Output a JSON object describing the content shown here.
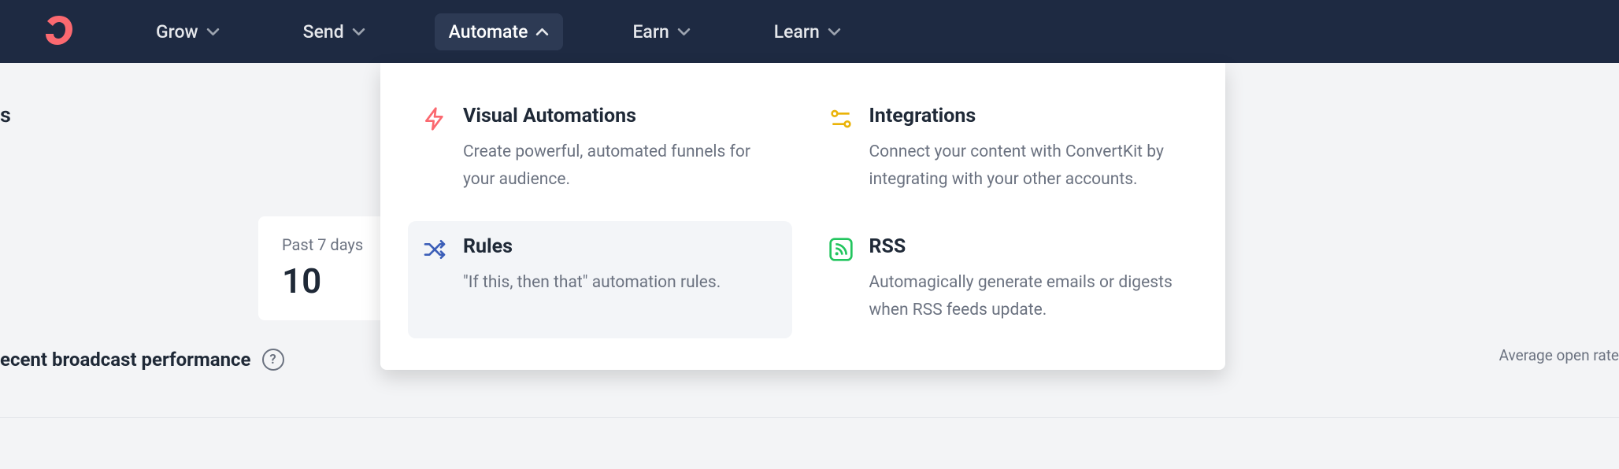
{
  "nav": {
    "items": [
      {
        "label": "Grow"
      },
      {
        "label": "Send"
      },
      {
        "label": "Automate"
      },
      {
        "label": "Earn"
      },
      {
        "label": "Learn"
      }
    ]
  },
  "dashboard": {
    "subscribers_label_suffix": "s",
    "stat_card": {
      "label": "Past 7 days",
      "value": "10"
    },
    "broadcast_label": "ecent broadcast performance",
    "side_label": "Average open rate"
  },
  "dropdown": {
    "items": [
      {
        "title": "Visual Automations",
        "desc": "Create powerful, automated funnels for your audience."
      },
      {
        "title": "Integrations",
        "desc": "Connect your content with ConvertKit by integrating with your other accounts."
      },
      {
        "title": "Rules",
        "desc": "\"If this, then that\" automation rules."
      },
      {
        "title": "RSS",
        "desc": "Automagically generate emails or digests when RSS feeds update."
      }
    ]
  }
}
